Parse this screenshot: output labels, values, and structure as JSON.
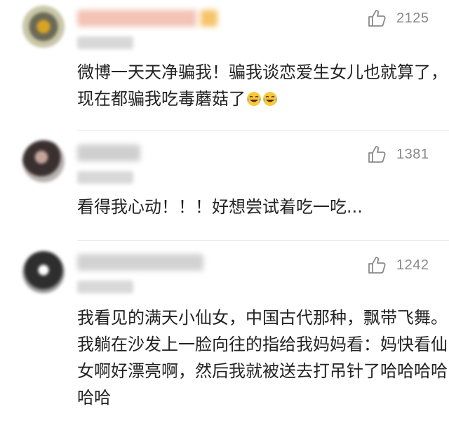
{
  "comments": [
    {
      "likes": "2125",
      "text": "微博一天天净骗我！骗我谈恋爱生女儿也就算了，现在都骗我吃毒蘑菇了",
      "emoji": [
        "laughing-tears-emoji",
        "laughing-tears-emoji"
      ]
    },
    {
      "likes": "1381",
      "text": "看得我心动！！！好想尝试着吃一吃..."
    },
    {
      "likes": "1242",
      "text": "我看见的满天小仙女，中国古代那种，飘带飞舞。我躺在沙发上一脸向往的指给我妈妈看：妈快看仙女啊好漂亮啊，然后我就被送去打吊针了哈哈哈哈哈哈"
    }
  ],
  "icons": {
    "like": "thumbs-up-outline-icon"
  },
  "colors": {
    "text": "#222222",
    "count": "#8a8a8a",
    "divider": "#e6e6e6"
  }
}
